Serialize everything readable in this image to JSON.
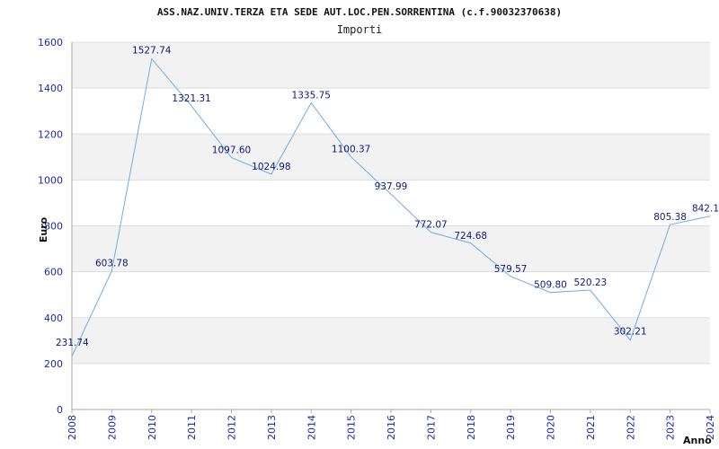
{
  "chart_data": {
    "type": "line",
    "title": "ASS.NAZ.UNIV.TERZA ETA SEDE AUT.LOC.PEN.SORRENTINA (c.f.90032370638)",
    "subtitle": "Importi",
    "xlabel": "Anno",
    "ylabel": "Euro",
    "ylim": [
      0,
      1600
    ],
    "yticks": [
      0,
      200,
      400,
      600,
      800,
      1000,
      1200,
      1400,
      1600
    ],
    "grid": "horizontal bands",
    "x": [
      "2008",
      "2009",
      "2010",
      "2011",
      "2012",
      "2013",
      "2014",
      "2015",
      "2016",
      "2017",
      "2018",
      "2019",
      "2020",
      "2021",
      "2022",
      "2023",
      "2024"
    ],
    "values": [
      231.74,
      603.78,
      1527.74,
      1321.31,
      1097.6,
      1024.98,
      1335.75,
      1100.37,
      937.99,
      772.07,
      724.68,
      579.57,
      509.8,
      520.23,
      302.21,
      805.38,
      842.1
    ],
    "data_labels": [
      "231.74",
      "603.78",
      "1527.74",
      "1321.31",
      "1097.60",
      "1024.98",
      "1335.75",
      "1100.37",
      "937.99",
      "772.07",
      "724.68",
      "579.57",
      "509.80",
      "520.23",
      "302.21",
      "805.38",
      "842.1"
    ],
    "colors": {
      "line": "#6aaee6",
      "tick_text": "#1a2aa8",
      "label_text": "#0d1a7a",
      "band": "#f2f2f2",
      "grid": "#dddddd"
    }
  }
}
